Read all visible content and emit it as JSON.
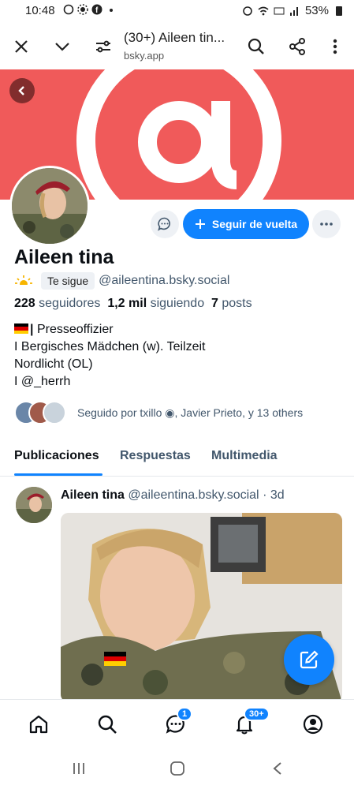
{
  "status_bar": {
    "time": "10:48",
    "battery": "53%",
    "icons": [
      "whatsapp-icon",
      "settings-icon",
      "facebook-icon",
      "dot-icon",
      "alarm-icon",
      "wifi-icon",
      "lte-icon",
      "signal-icon",
      "battery-icon"
    ]
  },
  "browser": {
    "title": "(30+) Aileen tin...",
    "url": "bsky.app",
    "icons": [
      "close-icon",
      "chevron-down-icon",
      "site-settings-icon",
      "search-icon",
      "share-icon",
      "more-vert-icon"
    ]
  },
  "profile": {
    "display_name": "Aileen tina",
    "follows_you": "Te sigue",
    "handle": "@aileentina.bsky.social",
    "followers_count": "228",
    "followers_label": "seguidores",
    "following_count": "1,2 mil",
    "following_label": "siguiendo",
    "posts_count": "7",
    "posts_label": "posts",
    "bio_lines": [
      "Presseoffizier",
      "I Bergisches Mädchen (w). Teilzeit",
      "Nordlicht (OL)",
      "I @_herrh"
    ],
    "followed_by": "Seguido por txillo ◉, Javier Prieto, y 13 others",
    "follow_button": "Seguir de vuelta"
  },
  "tabs": [
    "Publicaciones",
    "Respuestas",
    "Multimedia"
  ],
  "post": {
    "author": "Aileen tina",
    "handle": "@aileentina.bsky.social",
    "time": "· 3d"
  },
  "nav": {
    "messages_badge": "1",
    "notifications_badge": "30+"
  },
  "colors": {
    "accent": "#1083fe",
    "banner": "#f05a5a"
  }
}
